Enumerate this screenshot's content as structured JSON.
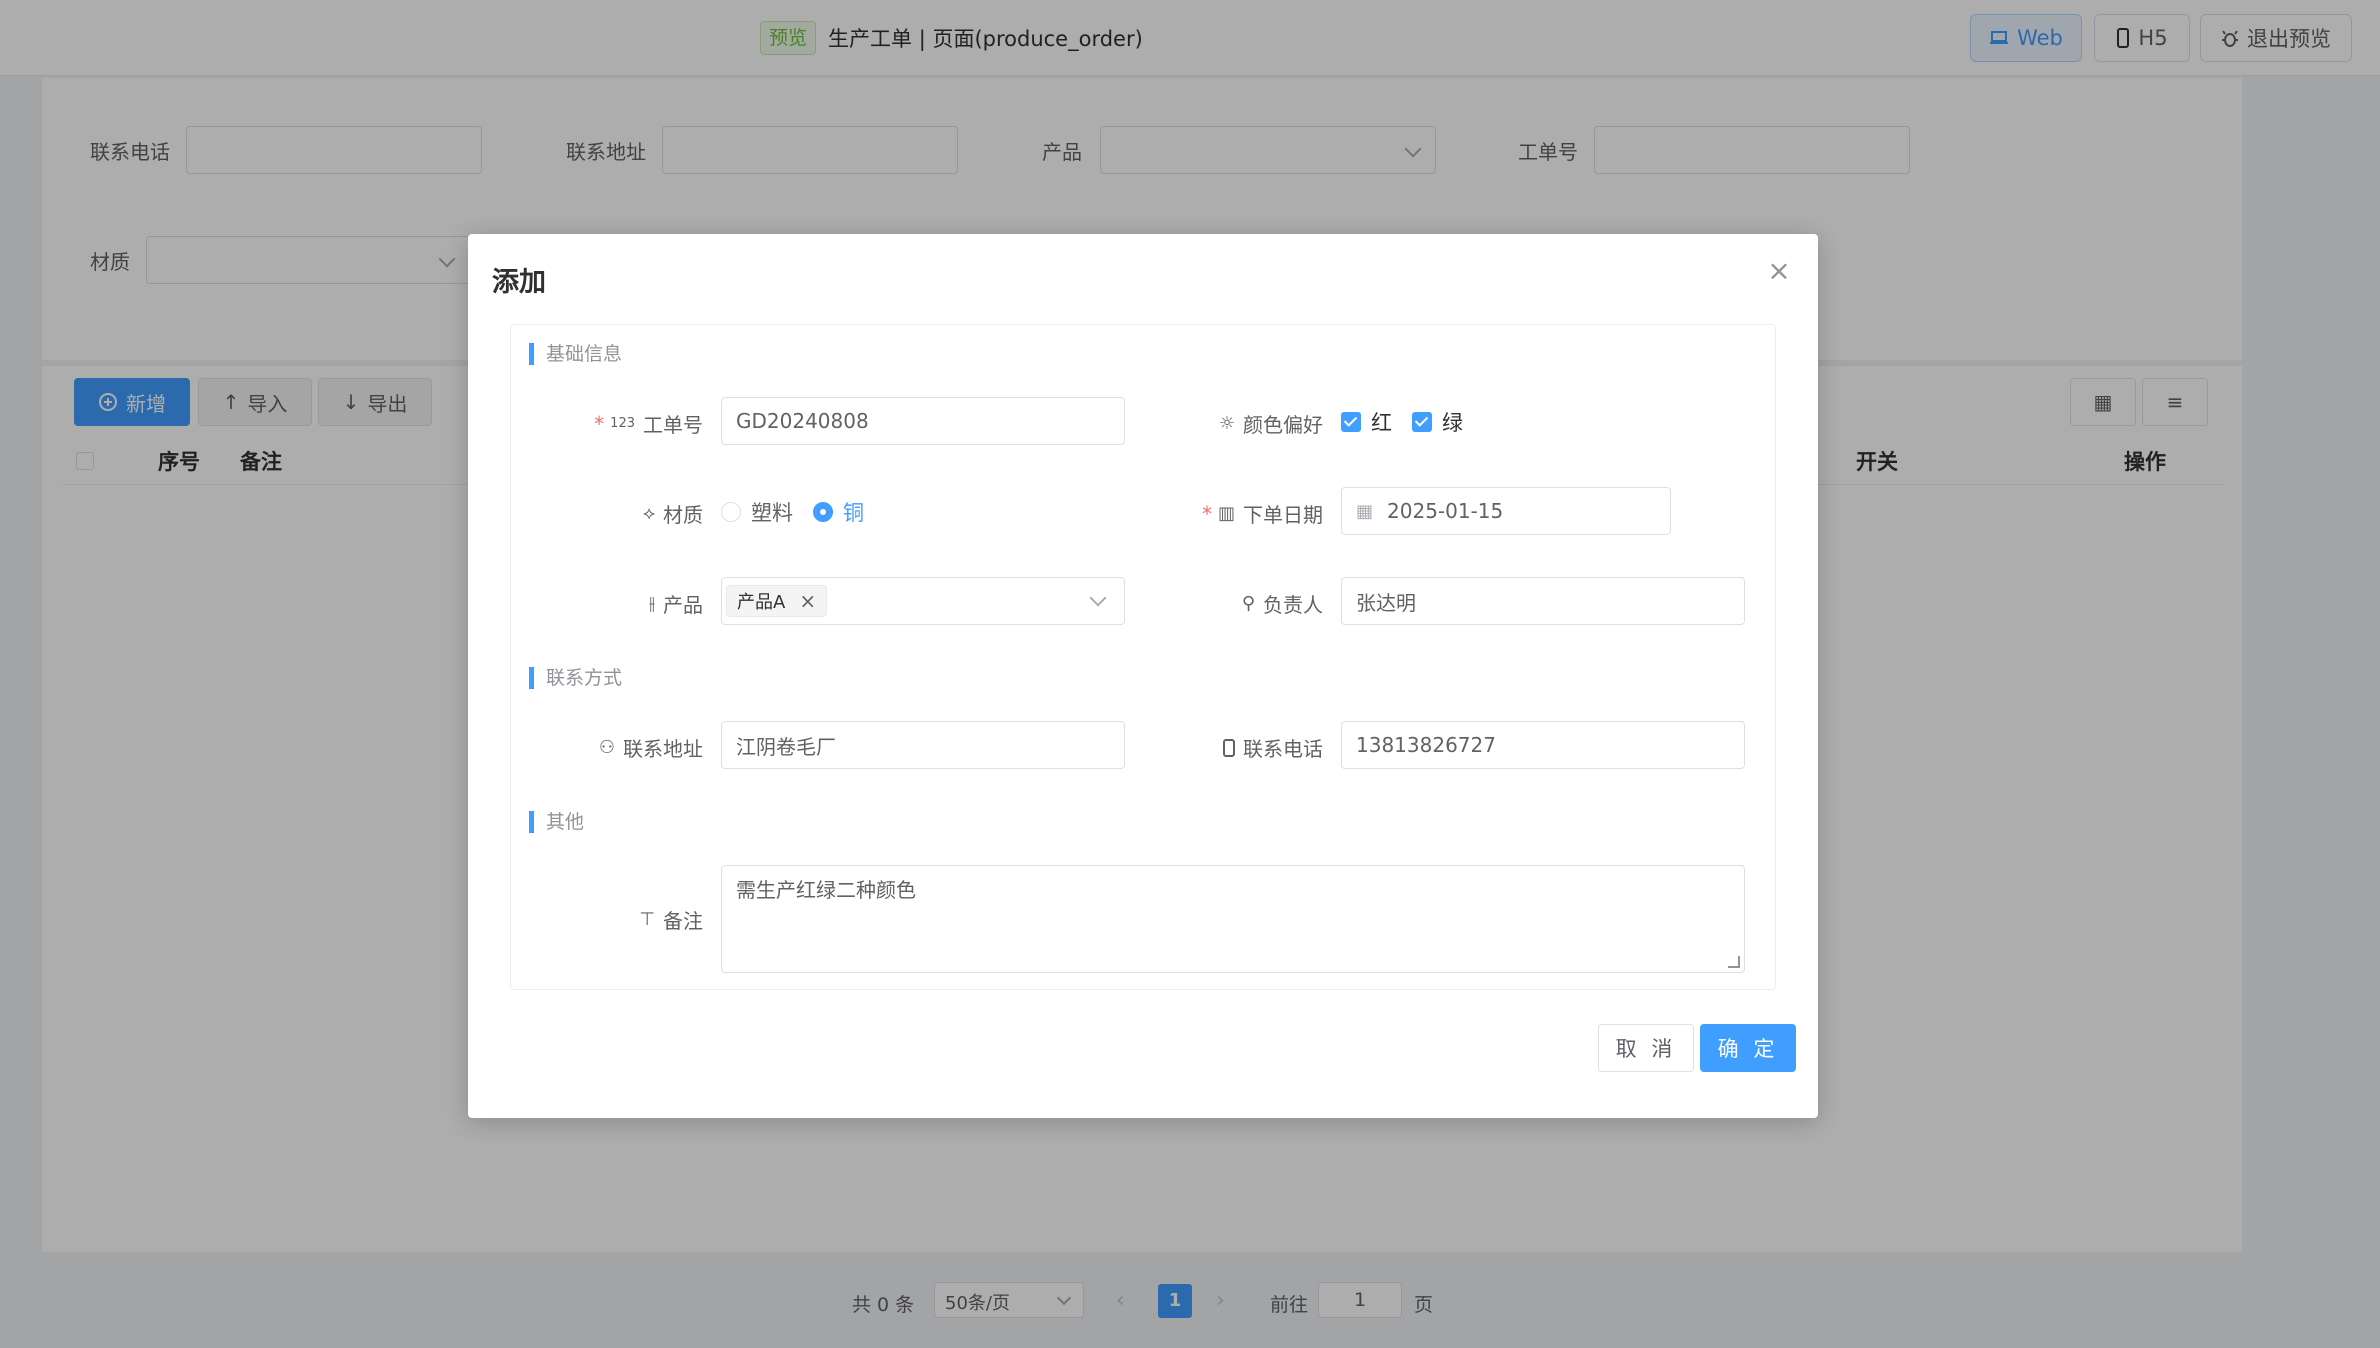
{
  "header": {
    "preview_tag": "预览",
    "title": "生产工单 | 页面(produce_order)",
    "btn_web": "Web",
    "btn_h5": "H5",
    "btn_exit": "退出预览"
  },
  "search": {
    "phone_label": "联系电话",
    "address_label": "联系地址",
    "product_label": "产品",
    "order_no_label": "工单号",
    "material_label": "材质"
  },
  "toolbar": {
    "add": "新增",
    "import": "导入",
    "export": "导出"
  },
  "table": {
    "headers": {
      "index": "序号",
      "remark": "备注",
      "switch": "开关",
      "action": "操作"
    }
  },
  "pagination": {
    "total": "共 0 条",
    "page_size": "50条/页",
    "current_page": "1",
    "goto_label": "前往",
    "goto_value": "1",
    "goto_suffix": "页"
  },
  "dialog": {
    "title": "添加",
    "sections": {
      "basic": "基础信息",
      "contact": "联系方式",
      "other": "其他"
    },
    "fields": {
      "order_no": {
        "label": "工单号",
        "value": "GD20240808"
      },
      "color": {
        "label": "颜色偏好",
        "options": [
          "红",
          "绿"
        ]
      },
      "material": {
        "label": "材质",
        "options": [
          "塑料",
          "铜"
        ]
      },
      "order_date": {
        "label": "下单日期",
        "value": "2025-01-15"
      },
      "product": {
        "label": "产品",
        "chip": "产品A"
      },
      "owner": {
        "label": "负责人",
        "value": "张达明"
      },
      "address": {
        "label": "联系地址",
        "value": "江阴卷毛厂"
      },
      "phone": {
        "label": "联系电话",
        "value": "13813826727"
      },
      "remark": {
        "label": "备注",
        "value": "需生产红绿二种颜色"
      }
    },
    "cancel": "取 消",
    "confirm": "确 定"
  },
  "icons": {
    "laptop": "laptop-icon",
    "phone": "mobile-icon",
    "exit": "bug-icon"
  },
  "colors": {
    "primary": "#409eff",
    "required": "#f56c6c",
    "success_tag": "#67c23a"
  }
}
